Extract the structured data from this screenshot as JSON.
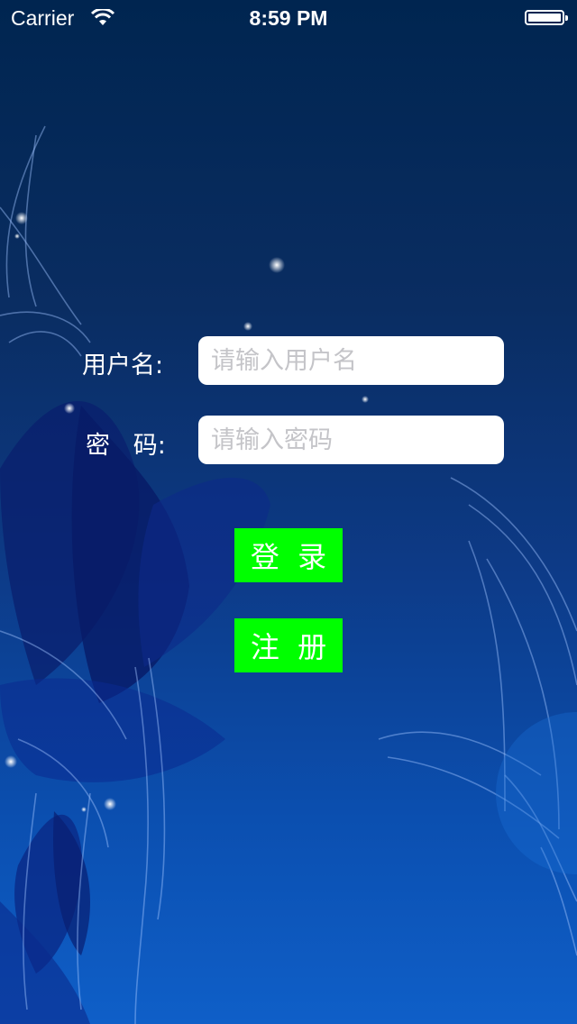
{
  "status_bar": {
    "carrier": "Carrier",
    "time": "8:59 PM"
  },
  "login_form": {
    "username_label": "用户名:",
    "username_placeholder": "请输入用户名",
    "password_label": "密   码:",
    "password_placeholder": "请输入密码"
  },
  "buttons": {
    "login_label": "登  录",
    "register_label": "注  册"
  },
  "colors": {
    "button_bg": "#00ff00",
    "button_text": "#ffffff",
    "background_top": "#002550",
    "background_bottom": "#0f5fc8"
  },
  "icons": {
    "wifi": "wifi-icon",
    "battery": "battery-icon"
  }
}
